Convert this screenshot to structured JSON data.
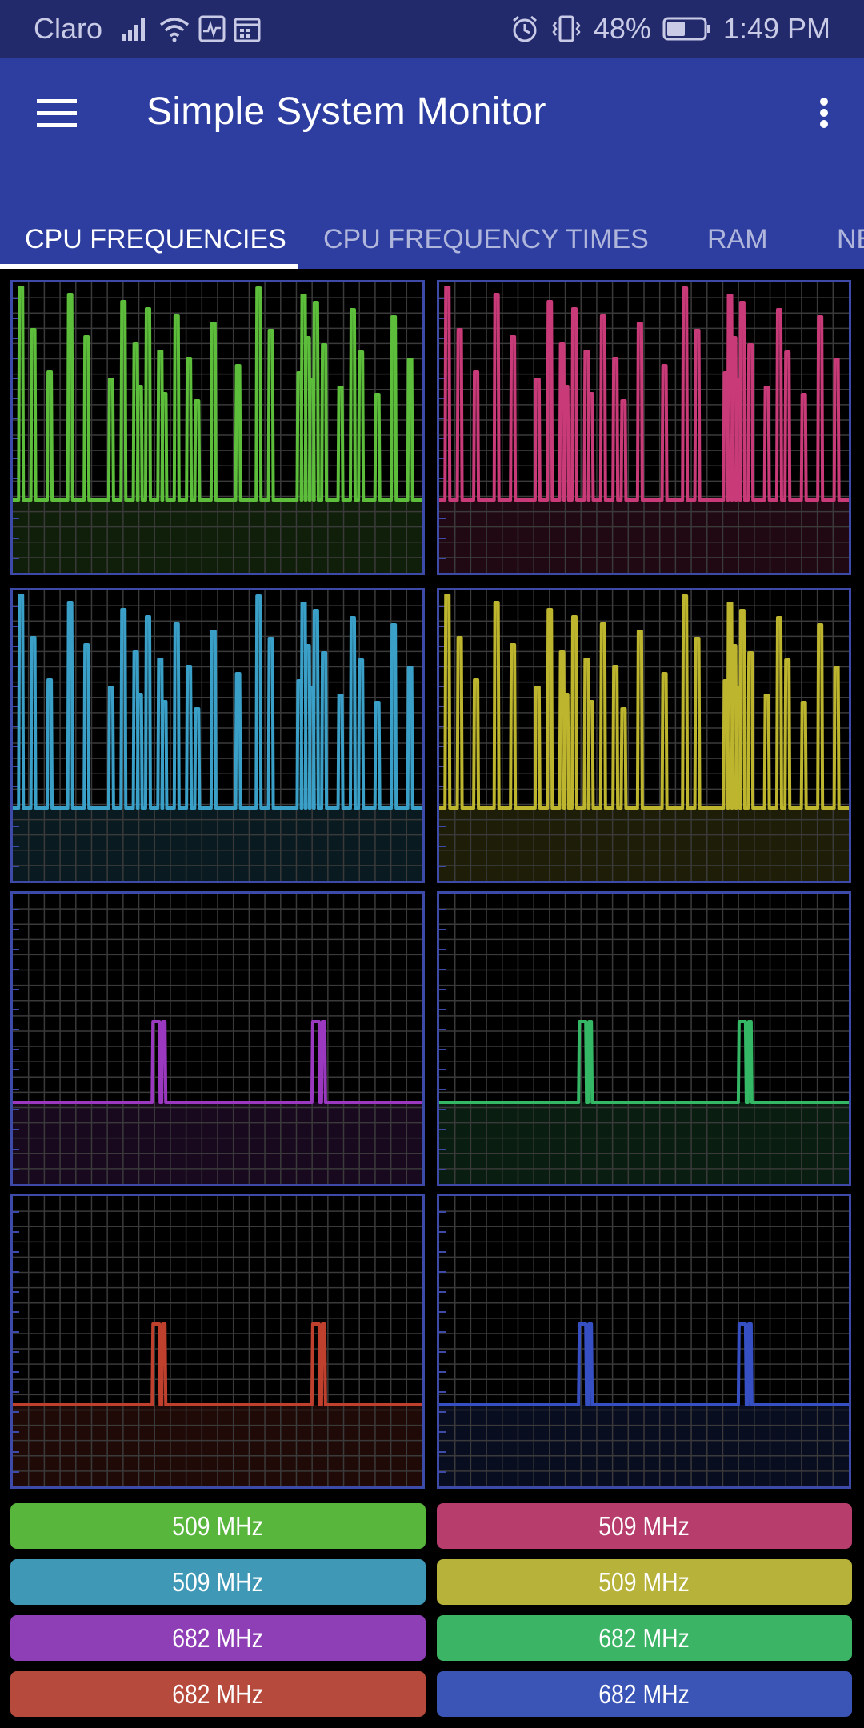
{
  "status_bar": {
    "carrier": "Claro",
    "battery": "48%",
    "time": "1:49 PM",
    "icons": [
      "signal-icon",
      "wifi-icon",
      "activity-icon",
      "calendar-icon",
      "alarm-icon",
      "vibrate-icon",
      "battery-icon"
    ]
  },
  "app_bar": {
    "title": "Simple System Monitor",
    "menu_icon": "hamburger-menu-icon",
    "more_icon": "more-vert-icon"
  },
  "tabs": [
    {
      "label": "CPU FREQUENCIES",
      "active": true
    },
    {
      "label": "CPU FREQUENCY TIMES",
      "active": false
    },
    {
      "label": "RAM",
      "active": false
    },
    {
      "label": "NE",
      "active": false
    }
  ],
  "cores": [
    {
      "color": "#5cbe3a",
      "freq": "509 MHz",
      "pattern": "busy"
    },
    {
      "color": "#c93a78",
      "freq": "509 MHz",
      "pattern": "busy"
    },
    {
      "color": "#3aa0c8",
      "freq": "509 MHz",
      "pattern": "busy"
    },
    {
      "color": "#bdb52e",
      "freq": "509 MHz",
      "pattern": "busy"
    },
    {
      "color": "#9a38c0",
      "freq": "682 MHz",
      "pattern": "idle"
    },
    {
      "color": "#35b866",
      "freq": "682 MHz",
      "pattern": "idle"
    },
    {
      "color": "#c0402e",
      "freq": "682 MHz",
      "pattern": "idle"
    },
    {
      "color": "#3650c4",
      "freq": "682 MHz",
      "pattern": "idle"
    }
  ],
  "button_colors": [
    "#57b63b",
    "#b73d6c",
    "#3e98b6",
    "#b7b23a",
    "#8e3fb6",
    "#3bb565",
    "#b64a3c",
    "#3b55b7"
  ],
  "busy_spikes": [
    0.02,
    0.05,
    0.09,
    0.14,
    0.18,
    0.24,
    0.27,
    0.3,
    0.31,
    0.33,
    0.36,
    0.37,
    0.4,
    0.43,
    0.45,
    0.49,
    0.55,
    0.6,
    0.63,
    0.7,
    0.71,
    0.72,
    0.73,
    0.74,
    0.76,
    0.8,
    0.83,
    0.85,
    0.89,
    0.93,
    0.97
  ],
  "idle_spikes": [
    0.35,
    0.74
  ]
}
